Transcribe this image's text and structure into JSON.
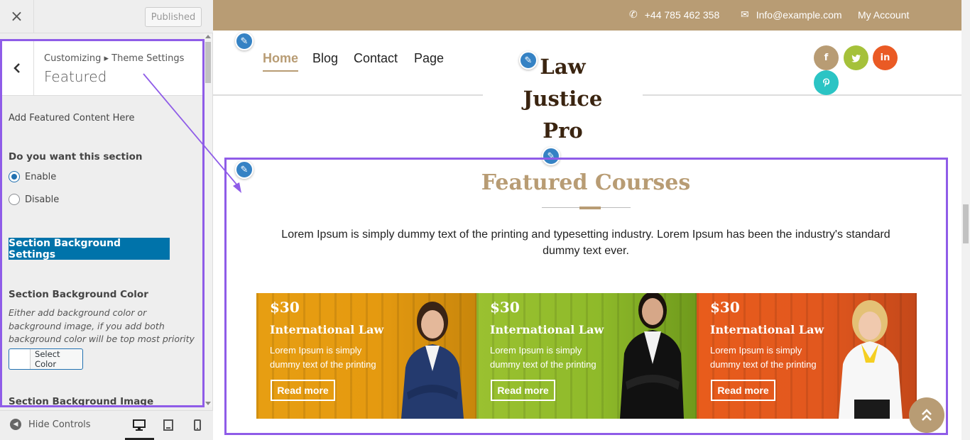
{
  "customizer": {
    "close_icon": "×",
    "publish_label": "Published",
    "breadcrumb": "Customizing ▸ Theme Settings",
    "panel_title": "Featured",
    "intro_text": "Add Featured Content Here",
    "section_toggle": {
      "heading": "Do you want this section",
      "options": [
        "Enable",
        "Disable"
      ],
      "selected": "Enable"
    },
    "bg_settings_button": "Section Background Settings",
    "bg_color": {
      "heading": "Section Background Color",
      "help": "Either add background color or background image, if you add both background color will be top most priority",
      "button": "Select Color"
    },
    "bg_image_heading": "Section Background Image",
    "footer": {
      "hide_controls": "Hide Controls",
      "devices": [
        "desktop-icon",
        "tablet-icon",
        "mobile-icon"
      ],
      "active_device": "desktop"
    }
  },
  "site": {
    "topbar": {
      "phone": "+44 785 462 358",
      "email": "Info@example.com",
      "account": "My Account"
    },
    "nav": {
      "items": [
        "Home",
        "Blog",
        "Contact",
        "Page"
      ],
      "active": "Home"
    },
    "logo_lines": [
      "Law",
      "Justice",
      "Pro"
    ],
    "social": [
      "facebook-icon",
      "twitter-icon",
      "linkedin-icon",
      "pinterest-icon"
    ],
    "section": {
      "title": "Featured Courses",
      "description": "Lorem Ipsum is simply dummy text of the printing and typesetting industry. Lorem Ipsum has been the industry's standard dummy text ever."
    },
    "cards": [
      {
        "price": "$30",
        "title": "International Law",
        "desc": "Lorem Ipsum is simply dummy text of the printing",
        "button": "Read more"
      },
      {
        "price": "$30",
        "title": "International Law",
        "desc": "Lorem Ipsum is simply dummy text of the printing",
        "button": "Read more"
      },
      {
        "price": "$30",
        "title": "International Law",
        "desc": "Lorem Ipsum is simply dummy text of the printing",
        "button": "Read more"
      }
    ]
  },
  "colors": {
    "accent_gold": "#b89c74",
    "highlight_purple": "#8f5ce8",
    "wp_blue": "#0073aa",
    "card_orange": "#e79e12",
    "card_green": "#9ac130",
    "card_red": "#e85c1c"
  }
}
